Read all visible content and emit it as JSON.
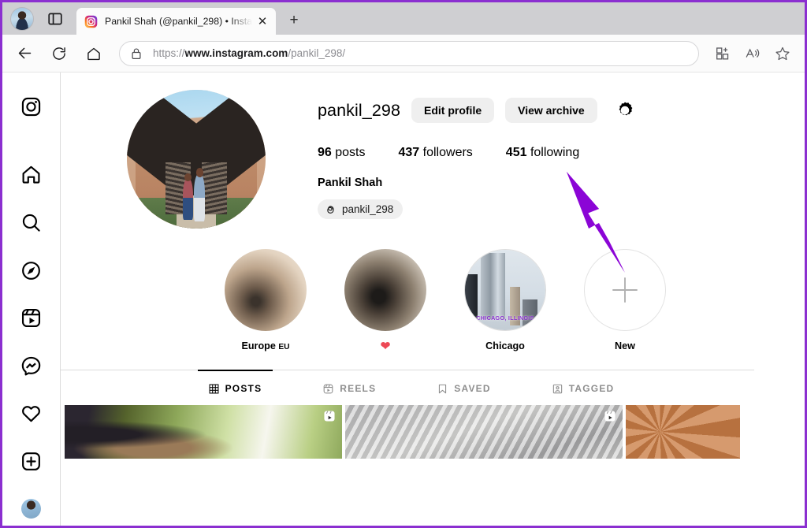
{
  "browser": {
    "profile_avatar": "browser-profile-avatar",
    "tab_actions_icon": "tab-actions-icon",
    "tab": {
      "favicon": "instagram-favicon",
      "title": "Pankil Shah (@pankil_298) • Insta",
      "close_label": "✕"
    },
    "new_tab_label": "+",
    "nav": {
      "back_icon": "back-arrow-icon",
      "reload_icon": "reload-icon",
      "home_icon": "home-icon"
    },
    "omnibox": {
      "lock_icon": "lock-icon",
      "url_scheme": "https://",
      "url_host": "www.instagram.com",
      "url_path": "/pankil_298/"
    },
    "toolbar_right": {
      "collections_icon": "collections-add-icon",
      "read_aloud_icon": "read-aloud-icon",
      "favorites_icon": "favorites-star-icon"
    }
  },
  "sidebar": {
    "items": [
      {
        "name": "instagram-logo",
        "icon": "instagram-logo-icon"
      },
      {
        "name": "home",
        "icon": "home-icon"
      },
      {
        "name": "search",
        "icon": "search-icon"
      },
      {
        "name": "explore",
        "icon": "compass-icon"
      },
      {
        "name": "reels",
        "icon": "reels-icon"
      },
      {
        "name": "messages",
        "icon": "messenger-icon"
      },
      {
        "name": "notifications",
        "icon": "heart-icon"
      },
      {
        "name": "create",
        "icon": "plus-square-icon"
      },
      {
        "name": "profile",
        "icon": "profile-avatar-icon"
      }
    ]
  },
  "profile": {
    "avatar_alt": "profile-picture",
    "username": "pankil_298",
    "edit_profile_label": "Edit profile",
    "view_archive_label": "View archive",
    "settings_icon": "settings-gear-icon",
    "stats": [
      {
        "count": "96",
        "label": "posts"
      },
      {
        "count": "437",
        "label": "followers"
      },
      {
        "count": "451",
        "label": "following"
      }
    ],
    "full_name": "Pankil Shah",
    "threads_icon": "threads-icon",
    "threads_handle": "pankil_298"
  },
  "highlights": [
    {
      "label": "Europe ",
      "label_small": "EU",
      "kind": "blur1"
    },
    {
      "label": "❤",
      "kind": "blur2",
      "heart": true
    },
    {
      "label": "Chicago",
      "kind": "chicago",
      "overlay_text": "CHICAGO, ILLINOIS"
    },
    {
      "label": "New",
      "kind": "new",
      "icon": "plus-icon"
    }
  ],
  "content_tabs": [
    {
      "label": "POSTS",
      "icon": "grid-icon",
      "active": true
    },
    {
      "label": "REELS",
      "icon": "reels-icon",
      "active": false
    },
    {
      "label": "SAVED",
      "icon": "bookmark-icon",
      "active": false
    },
    {
      "label": "TAGGED",
      "icon": "tagged-person-icon",
      "active": false
    }
  ],
  "posts": [
    {
      "name": "post-thumbnail-1",
      "has_reel_badge": true
    },
    {
      "name": "post-thumbnail-2",
      "has_reel_badge": true
    },
    {
      "name": "post-thumbnail-3",
      "has_reel_badge": false
    }
  ],
  "annotation": {
    "type": "arrow",
    "color": "#8B05D6",
    "points_at": "437 followers"
  },
  "colors": {
    "frame_border": "#8b2fd0",
    "chrome_titlebar": "#cfcfd2",
    "chrome_toolbar": "#fbfbfb",
    "ig_divider": "#dbdbdb",
    "ig_button_gray": "#efefef",
    "ig_muted_text": "#8e8e8e",
    "heart_red": "#ed4956",
    "annotation_purple": "#8B05D6"
  }
}
